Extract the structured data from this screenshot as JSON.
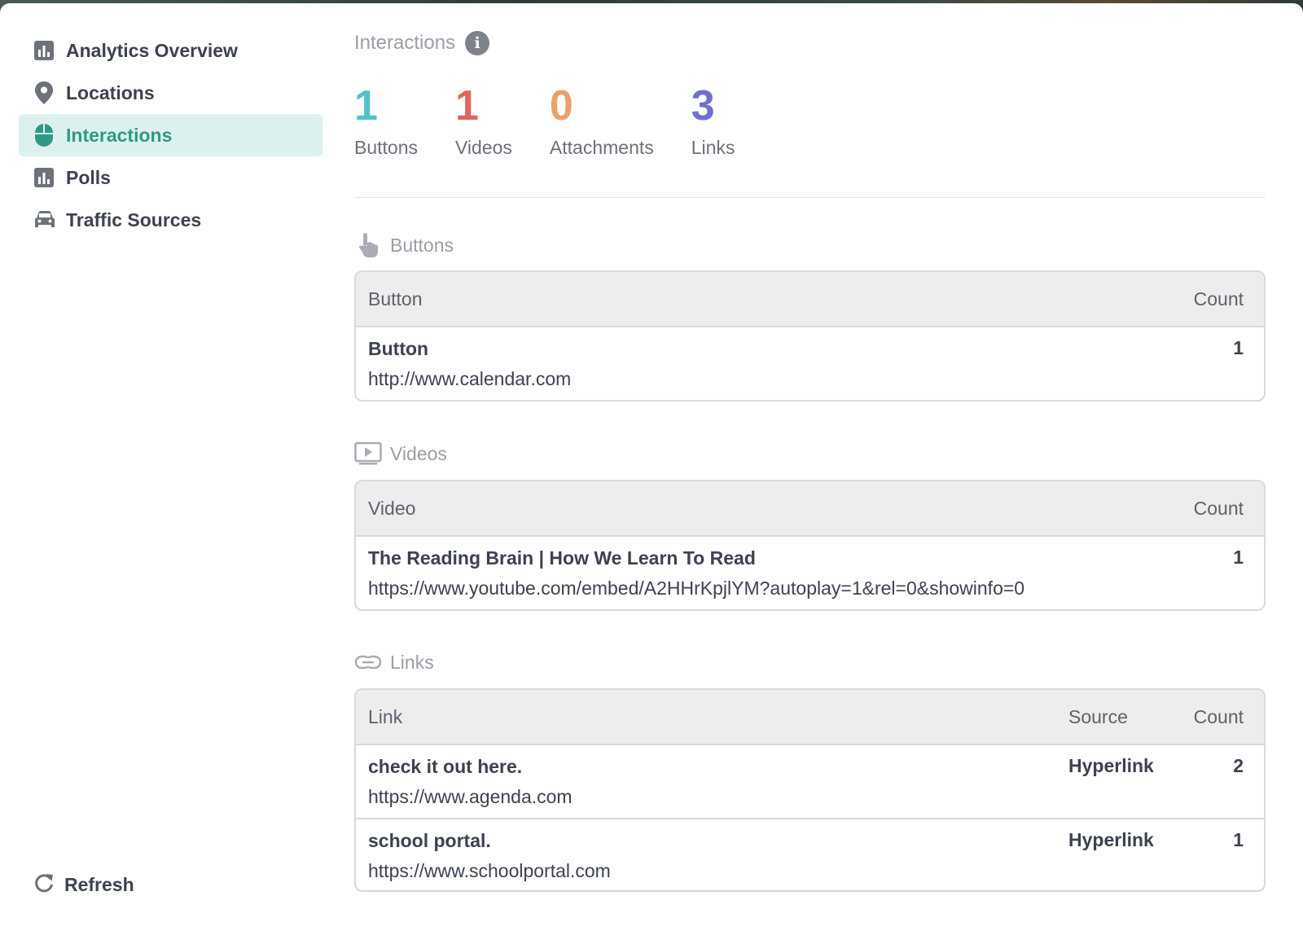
{
  "sidebar": {
    "items": [
      {
        "label": "Analytics Overview",
        "icon": "bar-chart-icon",
        "active": false
      },
      {
        "label": "Locations",
        "icon": "map-pin-icon",
        "active": false
      },
      {
        "label": "Interactions",
        "icon": "mouse-icon",
        "active": true
      },
      {
        "label": "Polls",
        "icon": "bar-chart-icon",
        "active": false
      },
      {
        "label": "Traffic Sources",
        "icon": "car-icon",
        "active": false
      }
    ],
    "refresh_label": "Refresh"
  },
  "main": {
    "title": "Interactions",
    "stats": [
      {
        "value": "1",
        "label": "Buttons",
        "color": "#4fc3c7"
      },
      {
        "value": "1",
        "label": "Videos",
        "color": "#e0665f"
      },
      {
        "value": "0",
        "label": "Attachments",
        "color": "#e9a06a"
      },
      {
        "value": "3",
        "label": "Links",
        "color": "#6f6fcf"
      }
    ],
    "buttons": {
      "title": "Buttons",
      "headers": {
        "main": "Button",
        "count": "Count"
      },
      "rows": [
        {
          "title": "Button",
          "url": "http://www.calendar.com",
          "count": "1"
        }
      ]
    },
    "videos": {
      "title": "Videos",
      "headers": {
        "main": "Video",
        "count": "Count"
      },
      "rows": [
        {
          "title": "The Reading Brain | How We Learn To Read",
          "url": "https://www.youtube.com/embed/A2HHrKpjlYM?autoplay=1&rel=0&showinfo=0",
          "count": "1"
        }
      ]
    },
    "links": {
      "title": "Links",
      "headers": {
        "main": "Link",
        "source": "Source",
        "count": "Count"
      },
      "rows": [
        {
          "title": "check it out here.",
          "url": "https://www.agenda.com",
          "source": "Hyperlink",
          "count": "2"
        },
        {
          "title": "school portal.",
          "url": "https://www.schoolportal.com",
          "source": "Hyperlink",
          "count": "1"
        }
      ]
    }
  }
}
